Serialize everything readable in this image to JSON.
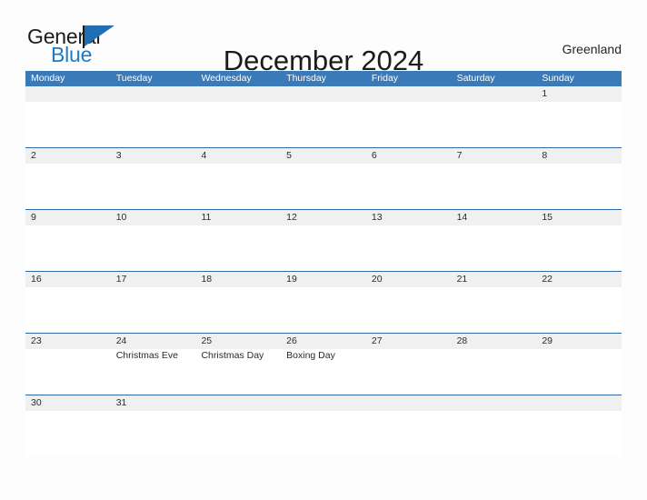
{
  "brand": {
    "name_part1": "General",
    "name_part2": "Blue",
    "flag_icon": "flag-icon",
    "color_primary": "#1f7ac4"
  },
  "header": {
    "title": "December 2024",
    "region": "Greenland"
  },
  "theme": {
    "header_blue": "#3b7ab8",
    "divider_blue": "#2f6ca5",
    "daynum_band": "#f0f0f0",
    "page_background": "#fdfdfd",
    "text": "#2b2b2b"
  },
  "calendar": {
    "month": "December",
    "year": "2024",
    "weekdays": [
      "Monday",
      "Tuesday",
      "Wednesday",
      "Thursday",
      "Friday",
      "Saturday",
      "Sunday"
    ],
    "weeks": [
      {
        "days": [
          {
            "num": "",
            "events": []
          },
          {
            "num": "",
            "events": []
          },
          {
            "num": "",
            "events": []
          },
          {
            "num": "",
            "events": []
          },
          {
            "num": "",
            "events": []
          },
          {
            "num": "",
            "events": []
          },
          {
            "num": "1",
            "events": []
          }
        ]
      },
      {
        "days": [
          {
            "num": "2",
            "events": []
          },
          {
            "num": "3",
            "events": []
          },
          {
            "num": "4",
            "events": []
          },
          {
            "num": "5",
            "events": []
          },
          {
            "num": "6",
            "events": []
          },
          {
            "num": "7",
            "events": []
          },
          {
            "num": "8",
            "events": []
          }
        ]
      },
      {
        "days": [
          {
            "num": "9",
            "events": []
          },
          {
            "num": "10",
            "events": []
          },
          {
            "num": "11",
            "events": []
          },
          {
            "num": "12",
            "events": []
          },
          {
            "num": "13",
            "events": []
          },
          {
            "num": "14",
            "events": []
          },
          {
            "num": "15",
            "events": []
          }
        ]
      },
      {
        "days": [
          {
            "num": "16",
            "events": []
          },
          {
            "num": "17",
            "events": []
          },
          {
            "num": "18",
            "events": []
          },
          {
            "num": "19",
            "events": []
          },
          {
            "num": "20",
            "events": []
          },
          {
            "num": "21",
            "events": []
          },
          {
            "num": "22",
            "events": []
          }
        ]
      },
      {
        "days": [
          {
            "num": "23",
            "events": []
          },
          {
            "num": "24",
            "events": [
              "Christmas Eve"
            ]
          },
          {
            "num": "25",
            "events": [
              "Christmas Day"
            ]
          },
          {
            "num": "26",
            "events": [
              "Boxing Day"
            ]
          },
          {
            "num": "27",
            "events": []
          },
          {
            "num": "28",
            "events": []
          },
          {
            "num": "29",
            "events": []
          }
        ]
      },
      {
        "days": [
          {
            "num": "30",
            "events": []
          },
          {
            "num": "31",
            "events": []
          },
          {
            "num": "",
            "events": []
          },
          {
            "num": "",
            "events": []
          },
          {
            "num": "",
            "events": []
          },
          {
            "num": "",
            "events": []
          },
          {
            "num": "",
            "events": []
          }
        ]
      }
    ]
  }
}
